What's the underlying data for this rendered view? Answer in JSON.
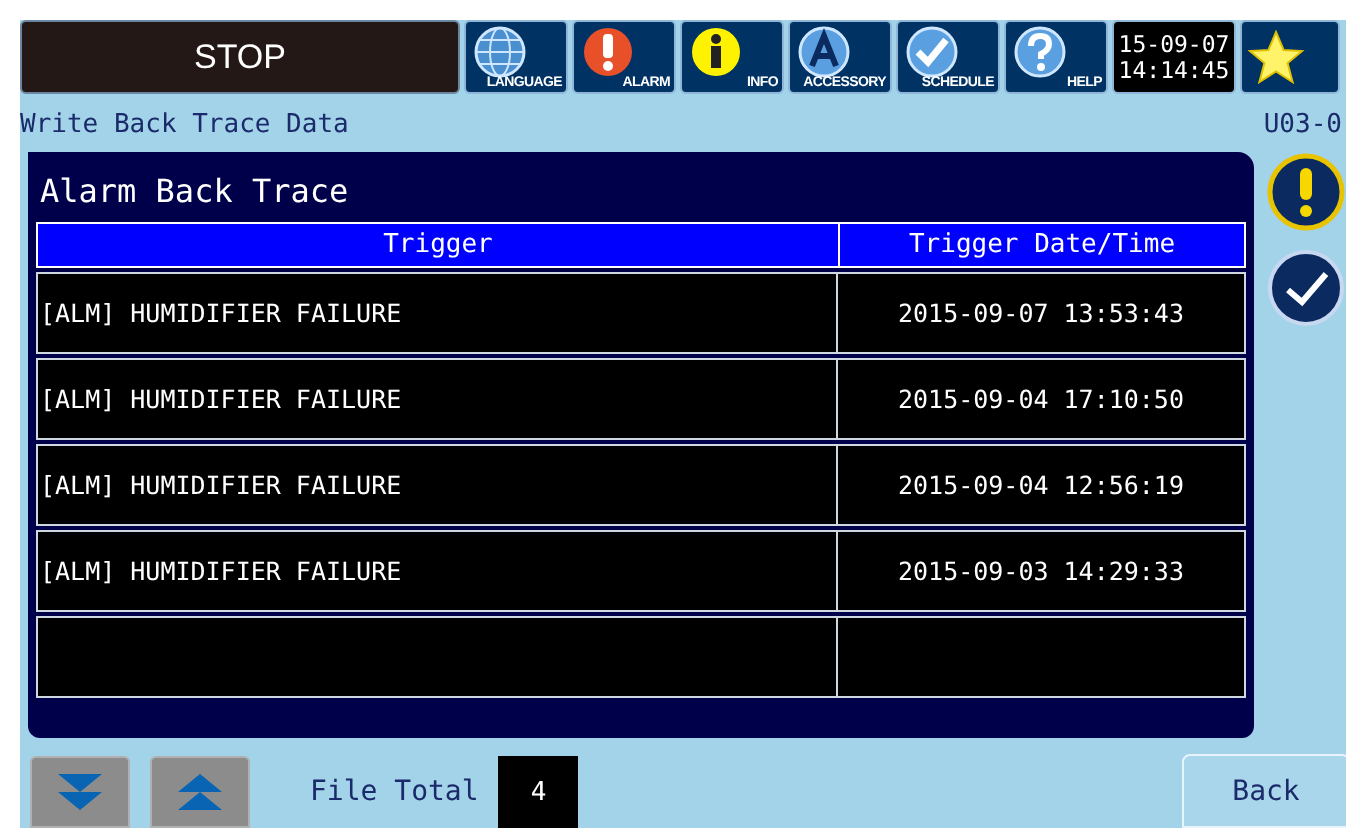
{
  "status": {
    "label": "STOP"
  },
  "toolbar": [
    {
      "label": "LANGUAGE"
    },
    {
      "label": "ALARM"
    },
    {
      "label": "INFO"
    },
    {
      "label": "ACCESSORY"
    },
    {
      "label": "SCHEDULE"
    },
    {
      "label": "HELP"
    }
  ],
  "clock": {
    "date": "15-09-07",
    "time": "14:14:45"
  },
  "screen_title": "Write Back Trace Data",
  "screen_id": "U03-0",
  "panel": {
    "title": "Alarm Back Trace",
    "table": {
      "columns": [
        "Trigger",
        "Trigger Date/Time"
      ],
      "rows": [
        {
          "trigger": "[ALM] HUMIDIFIER FAILURE",
          "datetime": "2015-09-07 13:53:43"
        },
        {
          "trigger": "[ALM] HUMIDIFIER FAILURE",
          "datetime": "2015-09-04 17:10:50"
        },
        {
          "trigger": "[ALM] HUMIDIFIER FAILURE",
          "datetime": "2015-09-04 12:56:19"
        },
        {
          "trigger": "[ALM] HUMIDIFIER FAILURE",
          "datetime": "2015-09-03 14:29:33"
        }
      ]
    }
  },
  "footer": {
    "label": "File Total",
    "count": "4",
    "back": "Back"
  }
}
